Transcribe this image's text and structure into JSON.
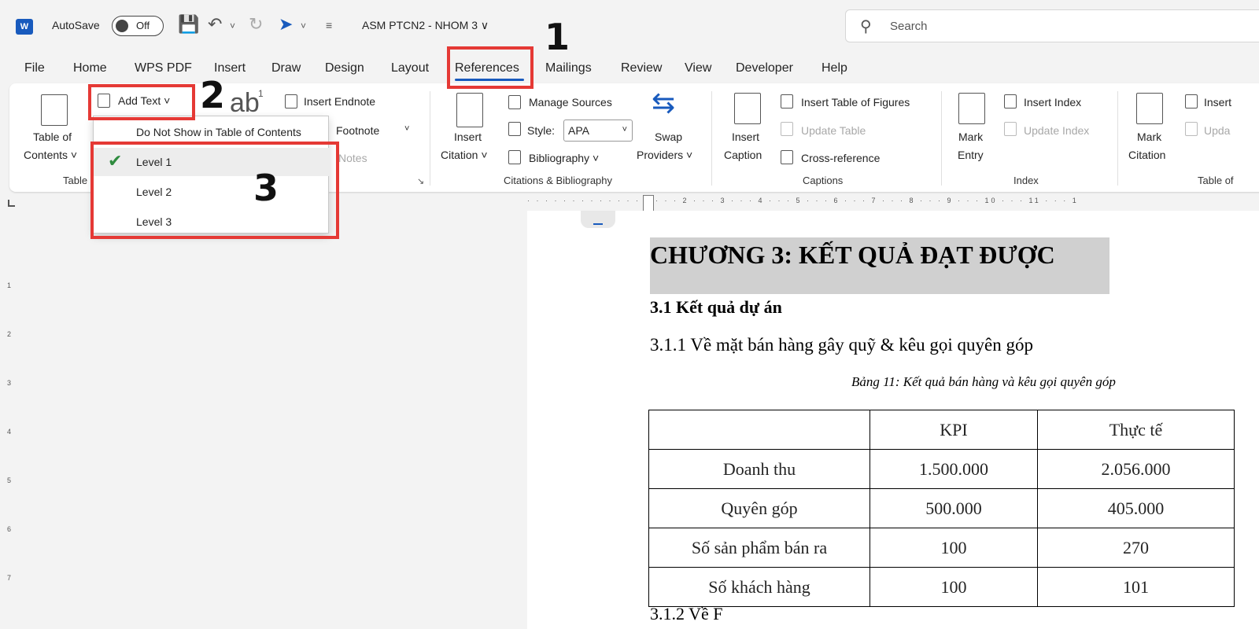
{
  "titlebar": {
    "logo": "W",
    "autosave_label": "AutoSave",
    "autosave_state": "Off",
    "doc_title": "ASM PTCN2 - NHOM 3 ∨",
    "search_placeholder": "Search"
  },
  "menu": [
    "File",
    "Home",
    "WPS PDF",
    "Insert",
    "Draw",
    "Design",
    "Layout",
    "References",
    "Mailings",
    "Review",
    "View",
    "Developer",
    "Help"
  ],
  "active_tab": "References",
  "ribbon": {
    "toc": {
      "label1": "Table of",
      "label2": "Contents ˅",
      "group": "Table"
    },
    "add_text": "Add Text ˅",
    "insert_endnote": "Insert Endnote",
    "footnote_partial": "Footnote",
    "notes_partial": "Notes",
    "insert_citation": {
      "label1": "Insert",
      "label2": "Citation ˅"
    },
    "manage_sources": "Manage Sources",
    "style_label": "Style:",
    "style_value": "APA",
    "bibliography": "Bibliography ˅",
    "swap": {
      "label1": "Swap",
      "label2": "Providers ˅"
    },
    "citations_group": "Citations & Bibliography",
    "insert_caption": {
      "label1": "Insert",
      "label2": "Caption"
    },
    "insert_table_of_figures": "Insert Table of Figures",
    "update_table": "Update Table",
    "cross_reference": "Cross-reference",
    "captions_group": "Captions",
    "mark_entry": {
      "label1": "Mark",
      "label2": "Entry"
    },
    "insert_index": "Insert Index",
    "update_index": "Update Index",
    "index_group": "Index",
    "mark_citation": {
      "label1": "Mark",
      "label2": "Citation"
    },
    "insert_toa_partial": "Insert",
    "update_toa_partial": "Upda",
    "toa_group_partial": "Table of"
  },
  "dropdown": {
    "items": [
      "Do Not Show in Table of Contents",
      "Level 1",
      "Level 2",
      "Level 3"
    ],
    "selected": "Level 1"
  },
  "annotations": [
    "1",
    "2",
    "3"
  ],
  "document": {
    "heading1": "CHƯƠNG 3: KẾT QUẢ ĐẠT ĐƯỢC",
    "heading2": "3.1 Kết quả dự án",
    "heading3": "3.1.1 Về mặt bán hàng gây quỹ & kêu gọi quyên góp",
    "caption": "Bảng 11: Kết quả bán hàng và kêu gọi quyên góp",
    "table": {
      "headers": [
        "",
        "KPI",
        "Thực tế"
      ],
      "rows": [
        [
          "Doanh thu",
          "1.500.000",
          "2.056.000"
        ],
        [
          "Quyên góp",
          "500.000",
          "405.000"
        ],
        [
          "Số sản phẩm bán ra",
          "100",
          "270"
        ],
        [
          "Số khách hàng",
          "100",
          "101"
        ]
      ]
    },
    "next_heading_partial": "3.1.2 Về F"
  },
  "ruler_h": "· · · · · · · · · · · · · 1 · · · 2 · · · 3 · · · 4 · · · 5 · · · 6 · · · 7 · · · 8 · · · 9 · · · 10 · · · 11 · · · 1",
  "ruler_v_numbers": [
    "1",
    "2",
    "3",
    "4",
    "5",
    "6",
    "7"
  ],
  "colors": {
    "accent": "#185abd",
    "highlight": "#e53935",
    "check": "#2e8b3e"
  }
}
